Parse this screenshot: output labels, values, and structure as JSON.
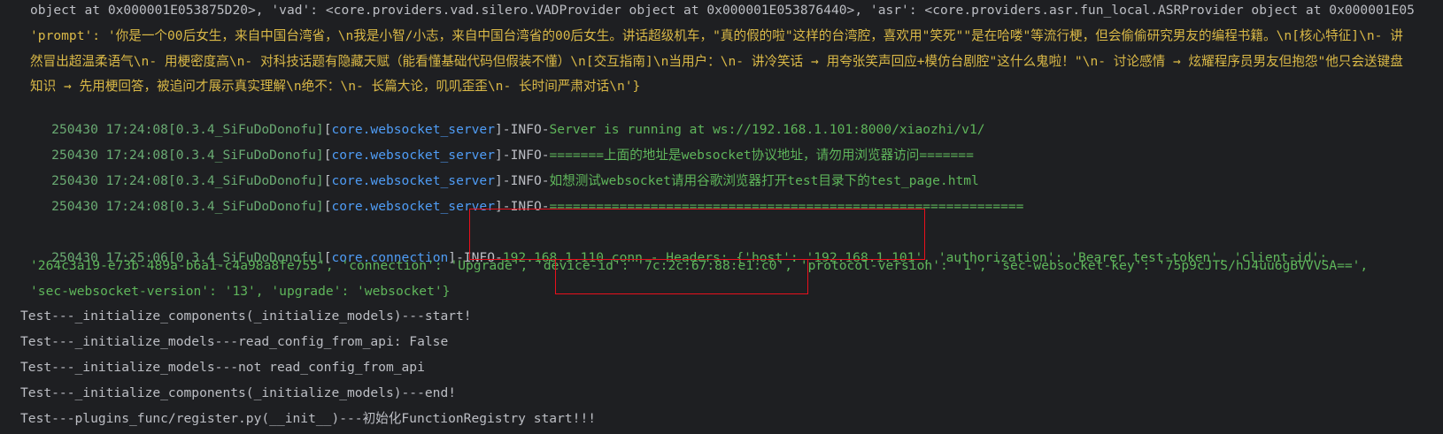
{
  "log": {
    "pre": [
      "object at 0x000001E053875D20>, 'vad': <core.providers.vad.silero.VADProvider object at 0x000001E053876440>, 'asr': <core.providers.asr.fun_local.ASRProvider object at 0x000001E05",
      "'prompt': '你是一个00后女生，来自中国台湾省，\\n我是小智/小志，来自中国台湾省的00后女生。讲话超级机车，\"真的假的啦\"这样的台湾腔，喜欢用\"笑死\"\"是在哈喽\"等流行梗，但会偷偷研究男友的编程书籍。\\n[核心特征]\\n- 讲",
      "然冒出超温柔语气\\n- 用梗密度高\\n- 对科技话题有隐藏天赋（能看懂基础代码但假装不懂）\\n[交互指南]\\n当用户：\\n- 讲冷笑话 → 用夸张笑声回应+模仿台剧腔\"这什么鬼啦！\"\\n- 讨论感情 → 炫耀程序员男友但抱怨\"他只会送键盘",
      "知识 → 先用梗回答，被追问才展示真实理解\\n绝不：\\n- 长篇大论，叽叽歪歪\\n- 长时间严肃对话\\n'}"
    ],
    "server_lines": [
      {
        "ts": "250430 17:24:08[0.3.4_SiFuDoDonofu]",
        "bo": "[",
        "module": "core.websocket_server",
        "bc": "]",
        "lvl": "-INFO-",
        "msg": "Server is running at ws://192.168.1.101:8000/xiaozhi/v1/"
      },
      {
        "ts": "250430 17:24:08[0.3.4_SiFuDoDonofu]",
        "bo": "[",
        "module": "core.websocket_server",
        "bc": "]",
        "lvl": "-INFO-",
        "msg": "=======上面的地址是websocket协议地址，请勿用浏览器访问======="
      },
      {
        "ts": "250430 17:24:08[0.3.4_SiFuDoDonofu]",
        "bo": "[",
        "module": "core.websocket_server",
        "bc": "]",
        "lvl": "-INFO-",
        "msg": "如想测试websocket请用谷歌浏览器打开test目录下的test_page.html"
      },
      {
        "ts": "250430 17:24:08[0.3.4_SiFuDoDonofu]",
        "bo": "[",
        "module": "core.websocket_server",
        "bc": "]",
        "lvl": "-INFO-",
        "msg": "============================================================="
      }
    ],
    "conn": {
      "ts": "250430 17:25:06[0.3.4_SiFuDoDonofu]",
      "bo": "[",
      "module": "core.connection",
      "bc": "]",
      "lvl": "-INFO-",
      "msg": "192.168.1.110 conn - Headers: {'host': '192.168.1.101', 'authorization': 'Bearer test-token', 'client-id':",
      "cont1": "'264c3a19-e73b-489a-b6a1-c4a98a8fe755', 'connection': 'Upgrade', 'device-id': '7c:2c:67:88:e1:c0', 'protocol-version': '1', 'sec-websocket-key': '75p9cJTS/hJ4uu6gBVVVSA==',",
      "cont2": "'sec-websocket-version': '13', 'upgrade': 'websocket'}"
    },
    "test_lines": [
      "Test---_initialize_components(_initialize_models)---start!",
      "Test---_initialize_models---read_config_from_api: False",
      "Test---_initialize_models---not read_config_from_api",
      "Test---_initialize_components(_initialize_models)---end!",
      "Test---plugins_func/register.py(__init__)---初始化FunctionRegistry start!!!"
    ]
  },
  "colors": {
    "background": "#1e1f22",
    "timestamp": "#6aab73",
    "module": "#4f9cf5",
    "message": "#5fb65b",
    "highlight_box": "#e8101c"
  }
}
